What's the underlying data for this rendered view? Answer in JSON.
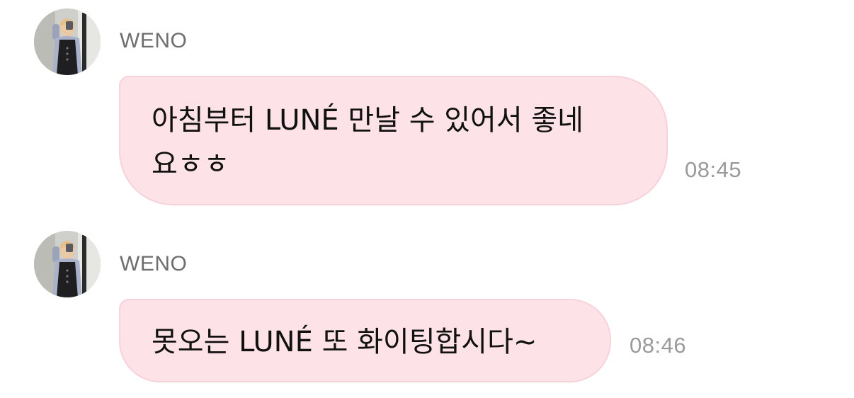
{
  "messages": [
    {
      "sender": "WENO",
      "text": "아침부터 LUNÉ 만날 수 있어서 좋네\n요ㅎㅎ",
      "time": "08:45",
      "avatar_icon": "profile-photo-avatar"
    },
    {
      "sender": "WENO",
      "text": "못오는 LUNÉ 또 화이팅합시다~",
      "time": "08:46",
      "avatar_icon": "profile-photo-avatar"
    }
  ],
  "colors": {
    "bubble_bg": "#fde3e8",
    "bubble_border": "#f8d2da",
    "sender_text": "#6e6e6e",
    "time_text": "#9a9a9a",
    "message_text": "#111111"
  }
}
